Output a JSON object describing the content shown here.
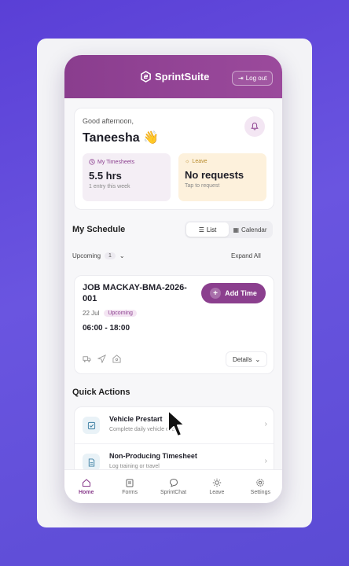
{
  "colors": {
    "brand": "#8b3f8e",
    "background": "#5a3fd6",
    "leave_tint": "#fdf1dc"
  },
  "header": {
    "brand_name": "SprintSuite",
    "logout_label": "Log out"
  },
  "greeting": {
    "subtitle": "Good afternoon,",
    "name": "Taneesha",
    "emoji": "👋",
    "timesheets": {
      "label": "My Timesheets",
      "value": "5.5 hrs",
      "sub": "1 entry this week"
    },
    "leave": {
      "label": "Leave",
      "value": "No requests",
      "sub": "Tap to request"
    }
  },
  "schedule": {
    "title": "My Schedule",
    "view_options": [
      "List",
      "Calendar"
    ],
    "selected_view": "List",
    "filter_label": "Upcoming",
    "filter_count": "1",
    "expand_label": "Expand All"
  },
  "job": {
    "title": "JOB MACKAY-BMA-2026-001",
    "date": "22 Jul",
    "status": "Upcoming",
    "time": "06:00 - 18:00",
    "add_time_label": "Add Time",
    "details_label": "Details"
  },
  "quick_actions": {
    "title": "Quick Actions",
    "items": [
      {
        "name": "Vehicle Prestart",
        "desc": "Complete daily vehicle check",
        "icon": "checklist-icon"
      },
      {
        "name": "Non-Producing Timesheet",
        "desc": "Log training or travel",
        "icon": "document-icon"
      }
    ]
  },
  "nav": [
    {
      "label": "Home",
      "icon": "home-icon",
      "active": true
    },
    {
      "label": "Forms",
      "icon": "clipboard-icon",
      "active": false
    },
    {
      "label": "SprintChat",
      "icon": "chat-icon",
      "active": false
    },
    {
      "label": "Leave",
      "icon": "sun-icon",
      "active": false
    },
    {
      "label": "Settings",
      "icon": "gear-icon",
      "active": false
    }
  ]
}
